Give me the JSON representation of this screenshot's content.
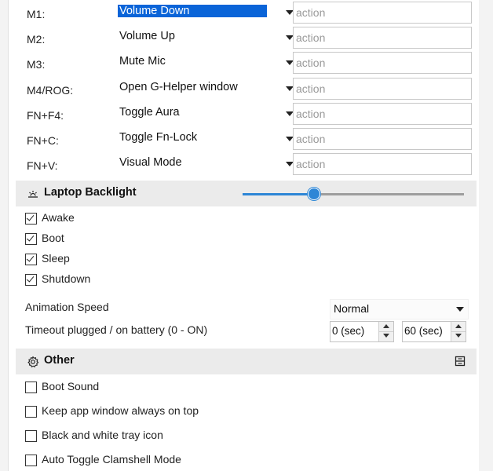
{
  "key_bindings": [
    {
      "key": "M1:",
      "value": "Volume Down",
      "placeholder": "action"
    },
    {
      "key": "M2:",
      "value": "Volume Up",
      "placeholder": "action"
    },
    {
      "key": "M3:",
      "value": "Mute Mic",
      "placeholder": "action"
    },
    {
      "key": "M4/ROG:",
      "value": "Open G-Helper window",
      "placeholder": "action"
    },
    {
      "key": "FN+F4:",
      "value": "Toggle Aura",
      "placeholder": "action"
    },
    {
      "key": "FN+C:",
      "value": "Toggle Fn-Lock",
      "placeholder": "action"
    },
    {
      "key": "FN+V:",
      "value": "Visual Mode",
      "placeholder": "action"
    }
  ],
  "backlight": {
    "title": "Laptop Backlight",
    "icon": "keyboard-backlight-icon",
    "level": 0.32,
    "accent_color": "#2d86d6",
    "options": [
      {
        "label": "Awake",
        "checked": true
      },
      {
        "label": "Boot",
        "checked": true
      },
      {
        "label": "Sleep",
        "checked": true
      },
      {
        "label": "Shutdown",
        "checked": true
      }
    ],
    "animation_speed_label": "Animation Speed",
    "animation_speed_value": "Normal",
    "timeout_label": "Timeout plugged / on battery (0 - ON)",
    "timeout_plugged": "0 (sec)",
    "timeout_battery": "60 (sec)"
  },
  "other": {
    "title": "Other",
    "icon": "gear-icon",
    "collapse_icon": "collapse-icon",
    "options": [
      {
        "label": "Boot Sound",
        "checked": false
      },
      {
        "label": "Keep app window always on top",
        "checked": false
      },
      {
        "label": "Black and white tray icon",
        "checked": false
      },
      {
        "label": "Auto Toggle Clamshell Mode",
        "checked": false
      }
    ]
  },
  "colors": {
    "selection": "#0a64d8",
    "section_header_bg": "#ebebeb"
  }
}
